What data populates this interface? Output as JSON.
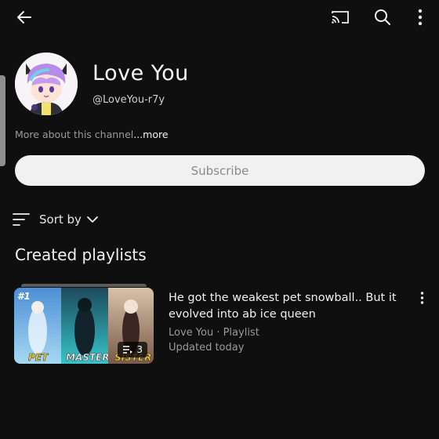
{
  "channel": {
    "name": "Love You",
    "handle": "@LoveYou-r7y",
    "about_text": "More about this channel",
    "about_more": "...more",
    "subscribe_label": "Subscribe"
  },
  "sort": {
    "label": "Sort by"
  },
  "section": {
    "title": "Created playlists"
  },
  "playlists": [
    {
      "title": "He got the weakest pet snowball.. But it evolved into ab ice queen",
      "owner_type": "Love You · Playlist",
      "updated": "Updated today",
      "video_count": "3",
      "thumb_labels": [
        "#1",
        "PET",
        "MASTER",
        "SISTER"
      ]
    }
  ],
  "icons": {
    "back": "back-arrow-icon",
    "cast": "cast-icon",
    "search": "search-icon",
    "menu": "more-vert-icon",
    "sort": "sort-icon",
    "chevron": "chevron-down-icon",
    "playlist": "playlist-icon"
  },
  "colors": {
    "background": "#0f0f0f",
    "subscribe_bg": "#f1f1f1",
    "secondary_text": "#9a9a9a"
  }
}
